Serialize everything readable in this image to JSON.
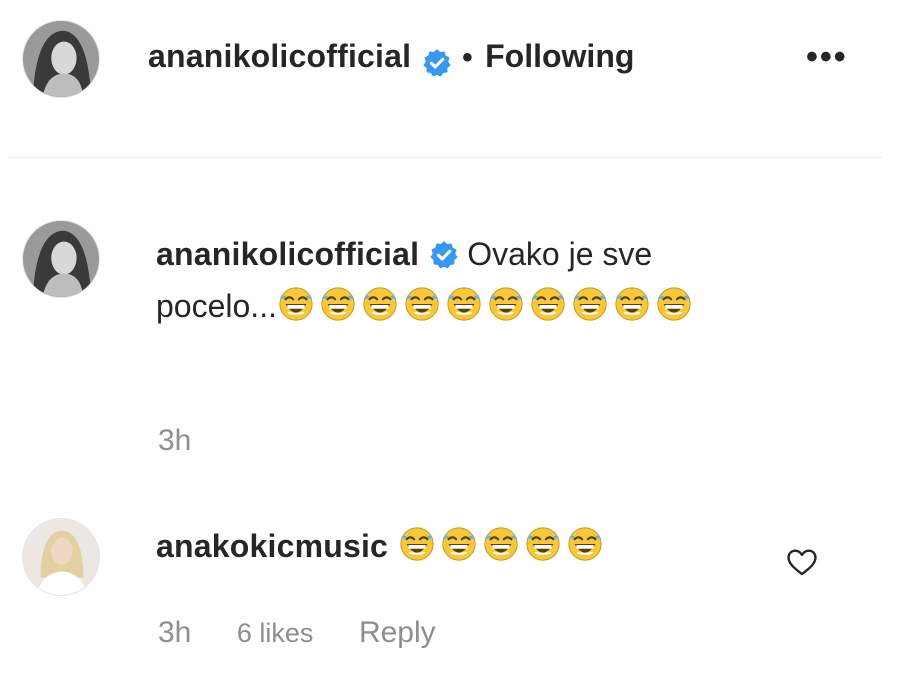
{
  "post_header": {
    "username": "ananikolicofficial",
    "separator": "•",
    "follow_status": "Following",
    "more_label": "•••"
  },
  "caption": {
    "username": "ananikolicofficial",
    "text_line1": "Ovako je sve",
    "text_line2": "pocelo...",
    "emoji_name": "rolling-on-floor-laughing",
    "emoji_count": 10,
    "time": "3h"
  },
  "comment": {
    "username": "anakokicmusic",
    "emoji_name": "rolling-on-floor-laughing",
    "emoji_count": 5,
    "time": "3h",
    "likes": "6 likes",
    "reply_label": "Reply"
  },
  "colors": {
    "verified_blue": "#3897f0",
    "emoji_yellow": "#f5c93a",
    "meta_gray": "#8e8e8e",
    "text": "#262626"
  },
  "icons": [
    "verified-badge-icon",
    "more-options-icon",
    "heart-icon",
    "laughing-emoji-icon"
  ]
}
